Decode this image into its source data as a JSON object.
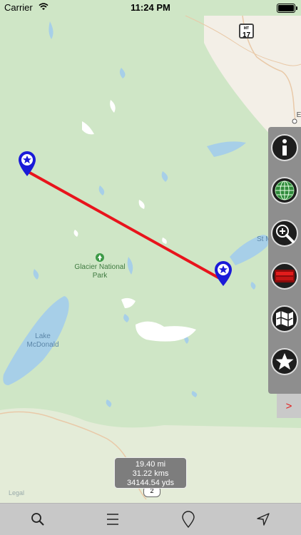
{
  "status": {
    "carrier": "Carrier",
    "time": "11:24 PM"
  },
  "map": {
    "park_label": "Glacier National Park",
    "lake_label": "Lake McDonald",
    "lake_label_partial": "St M... La...",
    "legal": "Legal",
    "route_shield": {
      "state": "MT",
      "number": "17"
    },
    "highway_badge": "2",
    "edge_letter": "E"
  },
  "distance": {
    "miles": "19.40 mi",
    "kms": "31.22 kms",
    "yards": "34144.54 yds"
  },
  "side_panel": {
    "buttons": [
      "info-icon",
      "globe-icon",
      "zoom-icon",
      "layers-icon",
      "map-icon",
      "favorites-icon"
    ],
    "collapse_label": ">"
  },
  "toolbar": {
    "buttons": [
      "search-icon",
      "menu-icon",
      "pin-icon",
      "navigate-icon"
    ]
  },
  "colors": {
    "route": "#e8141c",
    "pin": "#1a1ad8",
    "panel": "#8e8e8e"
  }
}
